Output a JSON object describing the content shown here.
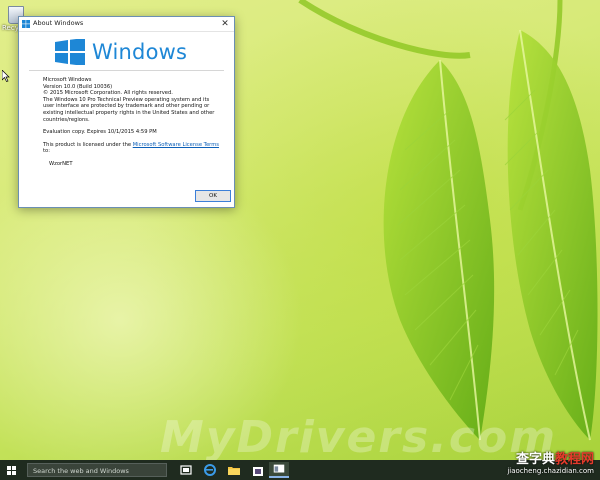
{
  "desktop": {
    "recycle_bin_label": "Recycle Bin"
  },
  "dialog": {
    "title": "About Windows",
    "close_glyph": "✕",
    "logo_text": "Windows",
    "product": "Microsoft Windows",
    "version": "Version 10.0 (Build 10036)",
    "copyright": "© 2015 Microsoft Corporation. All rights reserved.",
    "description": "The Windows 10 Pro Technical Preview operating system and its user interface are protected by trademark and other pending or existing intellectual property rights in the United States and other countries/regions.",
    "evaluation": "Evaluation copy. Expires 10/1/2015 4:59 PM",
    "license_prefix": "This product is licensed under the ",
    "license_link": "Microsoft Software License Terms",
    "license_suffix": " to:",
    "licensee": "WzorNET",
    "ok_label": "OK"
  },
  "taskbar": {
    "search_placeholder": "Search the web and Windows",
    "buttons": [
      "task-view-icon",
      "edge-icon",
      "file-explorer-icon",
      "store-icon",
      "app-window-icon"
    ]
  },
  "watermark": {
    "text": "MyDrivers.com",
    "site_cn_black": "查字典",
    "site_cn_red": "教程网",
    "site_url": "jiaocheng.chazidian.com"
  },
  "colors": {
    "accent": "#1e87d6",
    "taskbar": "#1f2b1f"
  }
}
